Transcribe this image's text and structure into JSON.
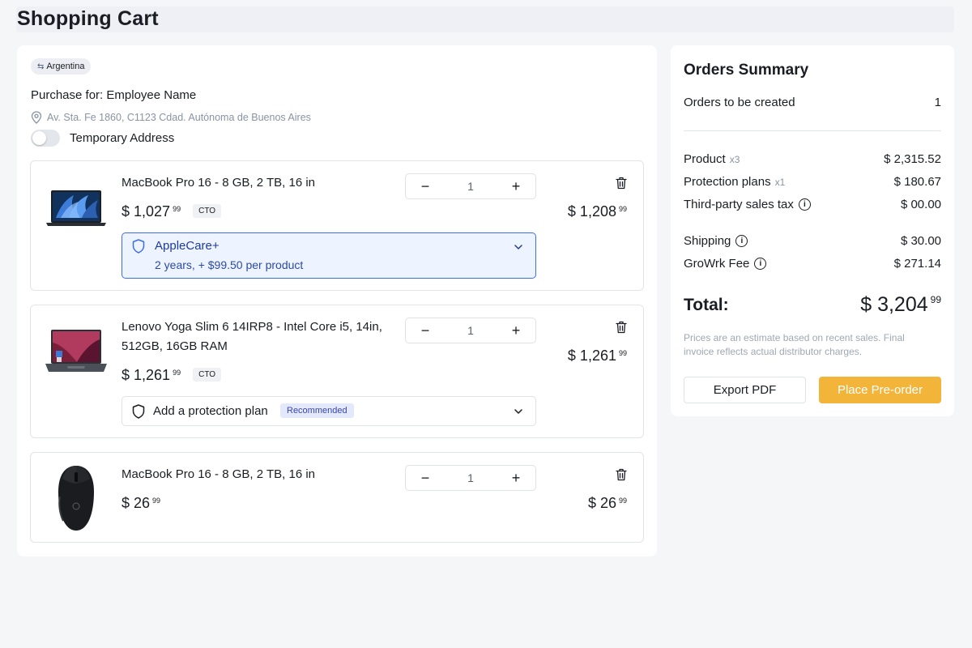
{
  "page": {
    "title": "Shopping Cart"
  },
  "cart": {
    "country": "Argentina",
    "purchase_for_label": "Purchase for:",
    "purchase_for_name": "Employee Name",
    "address": "Av. Sta. Fe 1860, C1123 Cdad. Autónoma de Buenos Aires",
    "temporary_address_label": "Temporary Address",
    "temporary_address_on": false,
    "items": [
      {
        "name": "MacBook Pro 16 - 8 GB, 2 TB, 16 in",
        "price_main": "$ 1,027",
        "price_cents": "99",
        "badge": "CTO",
        "quantity": "1",
        "total_main": "$ 1,208",
        "total_cents": "99",
        "protection": {
          "title": "AppleCare+",
          "subtitle": "2 years, + $99.50 per product"
        }
      },
      {
        "name_line1": "Lenovo Yoga Slim 6 14IRP8 - Intel Core i5, 14in,",
        "name_line2": "512GB, 16GB RAM",
        "price_main": "$ 1,261",
        "price_cents": "99",
        "badge": "CTO",
        "quantity": "1",
        "total_main": "$ 1,261",
        "total_cents": "99",
        "protection_prompt": "Add a protection plan",
        "protection_badge": "Recommended"
      },
      {
        "name": "MacBook Pro 16 - 8 GB, 2 TB, 16 in",
        "price_main": "$ 26",
        "price_cents": "99",
        "quantity": "1",
        "total_main": "$ 26",
        "total_cents": "99"
      }
    ],
    "stepper": {
      "minus": "−",
      "plus": "+"
    }
  },
  "summary": {
    "title": "Orders Summary",
    "orders_label": "Orders to be created",
    "orders_value": "1",
    "product_label": "Product",
    "product_mult": "x3",
    "product_value": "$ 2,315.52",
    "protection_label": "Protection plans",
    "protection_mult": "x1",
    "protection_value": "$ 180.67",
    "tax_label": "Third-party sales tax",
    "tax_value": "$ 00.00",
    "shipping_label": "Shipping",
    "shipping_value": "$ 30.00",
    "fee_label": "GroWrk Fee",
    "fee_value": "$ 271.14",
    "total_label": "Total:",
    "total_main": "$ 3,204",
    "total_cents": "99",
    "disclaimer": "Prices are an estimate based on recent sales. Final invoice reflects actual distributor charges.",
    "export_label": "Export PDF",
    "preorder_label": "Place Pre-order",
    "info_glyph": "i"
  },
  "colors": {
    "accent_orange": "#f3b43a",
    "applecare_blue": "#3d6fe0",
    "page_bg": "#f5f6f8"
  },
  "icons": {
    "swap": "swap-icon",
    "pin": "location-pin-icon",
    "trash": "trash-icon",
    "shield": "shield-icon",
    "chevron": "chevron-down-icon",
    "info": "info-icon"
  }
}
